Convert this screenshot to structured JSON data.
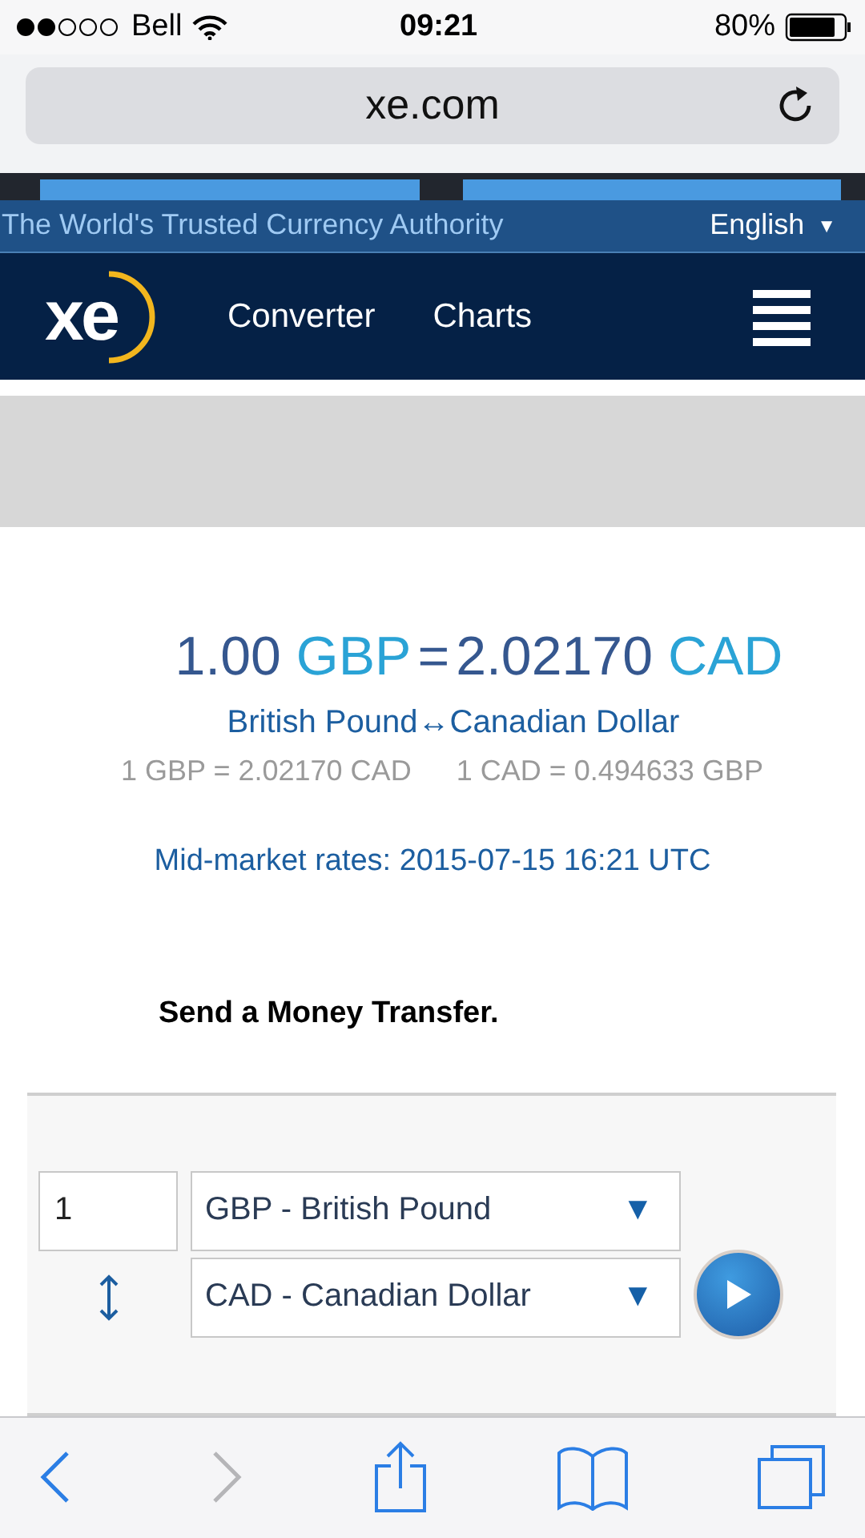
{
  "status_bar": {
    "carrier": "Bell",
    "time": "09:21",
    "battery": "80%"
  },
  "address_bar": {
    "url": "xe.com"
  },
  "top_strip": {
    "tagline": "The World's Trusted Currency Authority",
    "language": "English",
    "language_caret": "▼"
  },
  "nav": {
    "logo": "xe",
    "links": [
      "Converter",
      "Charts"
    ]
  },
  "result": {
    "amount": "1.00",
    "from_code": "GBP",
    "equals": "=",
    "converted": "2.02170",
    "to_code": "CAD",
    "from_name": "British Pound",
    "swap_arrow": "↔",
    "to_name": "Canadian Dollar",
    "rate_from": "1 GBP = 2.02170 CAD",
    "rate_to": "1 CAD = 0.494633 GBP",
    "timestamp": "Mid-market rates: 2015-07-15 16:21 UTC"
  },
  "transfer_heading": "Send a Money Transfer.",
  "converter": {
    "amount": "1",
    "from": "GBP - British Pound",
    "to": "CAD - Canadian Dollar",
    "caret": "▼"
  },
  "toolbar": [
    {
      "kind": "back",
      "disabled": false
    },
    {
      "kind": "forward",
      "disabled": true
    },
    {
      "kind": "share",
      "disabled": false
    },
    {
      "kind": "bookmarks",
      "disabled": false
    },
    {
      "kind": "tabs",
      "disabled": false
    }
  ]
}
